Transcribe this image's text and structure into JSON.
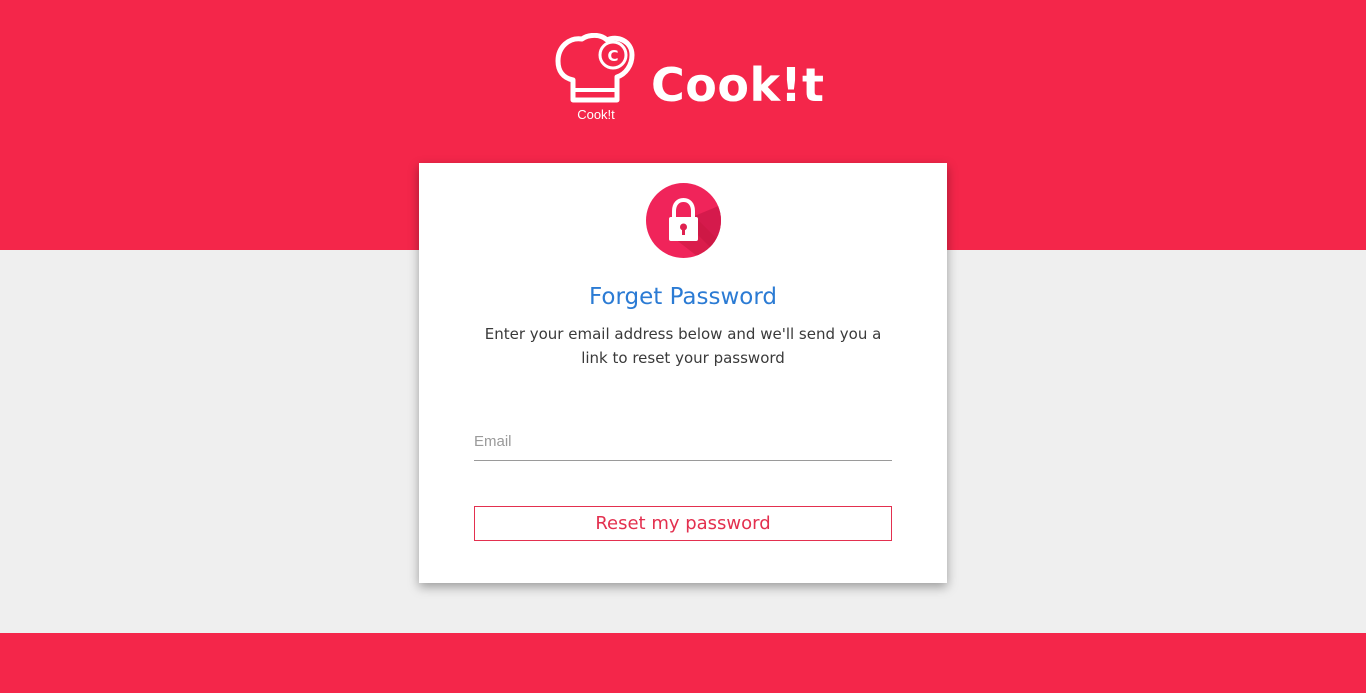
{
  "brand": {
    "name": "Cook!t",
    "logo_caption": "Cook!t",
    "logo_badge_letter": "C"
  },
  "forgot_password": {
    "title": "Forget Password",
    "description": "Enter your email address below and we'll send you a link to reset your password",
    "email_placeholder": "Email",
    "email_value": "",
    "submit_label": "Reset my password"
  },
  "icons": {
    "logo": "chef-hat-icon",
    "lock": "lock-icon"
  },
  "colors": {
    "brand_red": "#f4264a",
    "page_background": "#efefef",
    "title_blue": "#2b7bd4",
    "button_red": "#e3304f"
  }
}
